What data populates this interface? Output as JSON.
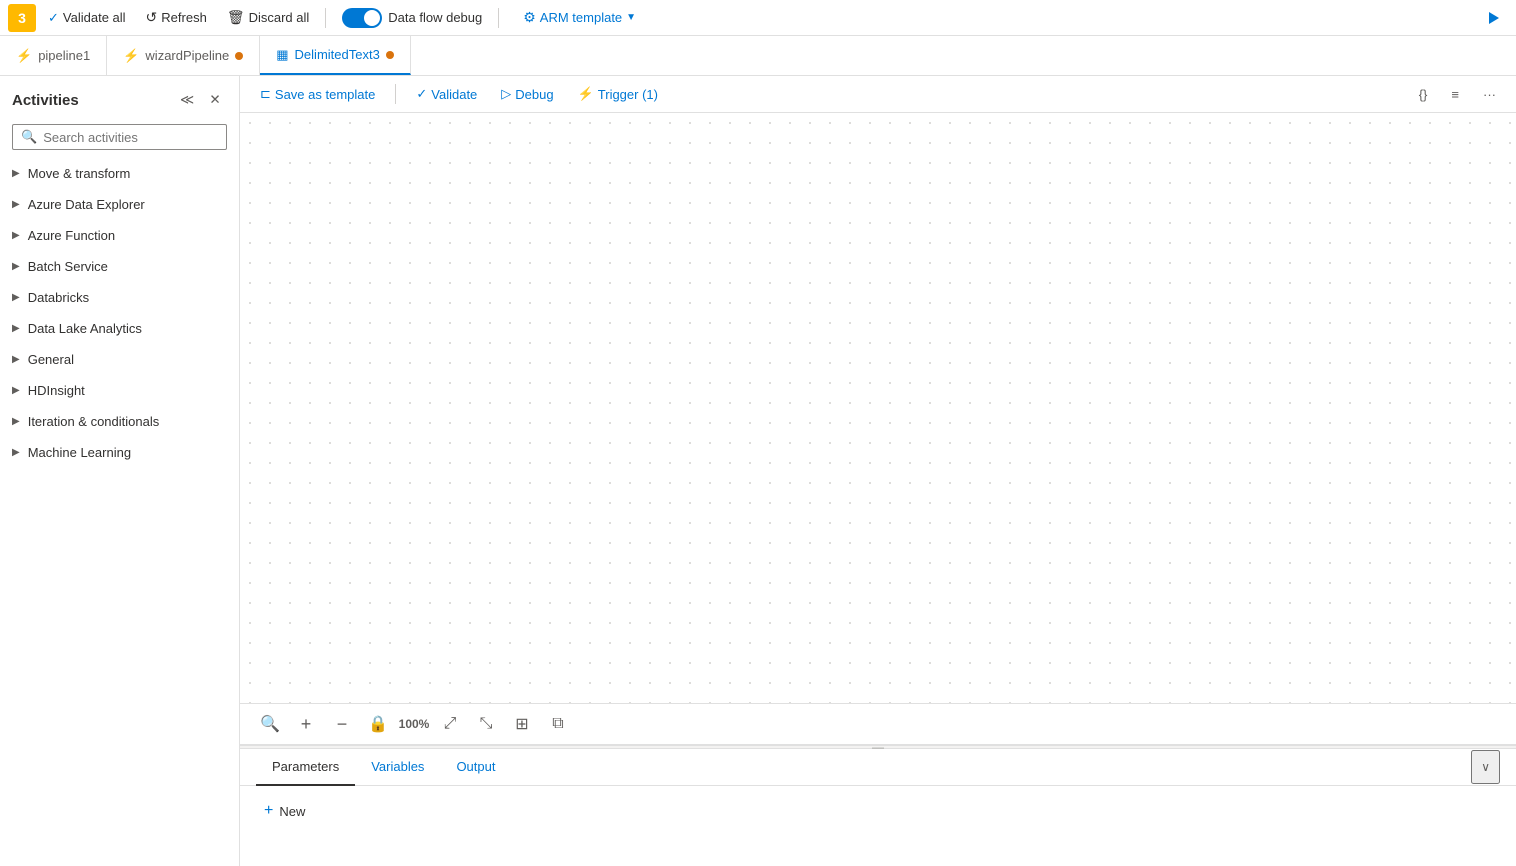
{
  "topToolbar": {
    "validateAll": "Validate all",
    "refresh": "Refresh",
    "discard": "Discard all",
    "dataFlowDebug": "Data flow debug",
    "armTemplate": "ARM template",
    "runIcon": "▶"
  },
  "tabs": [
    {
      "id": "pipeline1",
      "label": "pipeline1",
      "icon": "⚡",
      "active": false,
      "dot": false
    },
    {
      "id": "wizardPipeline",
      "label": "wizardPipeline",
      "icon": "⚡",
      "active": false,
      "dot": true
    },
    {
      "id": "DelimitedText3",
      "label": "DelimitedText3",
      "icon": "▦",
      "active": true,
      "dot": true
    }
  ],
  "sidebar": {
    "title": "Activities",
    "searchPlaceholder": "Search activities",
    "items": [
      {
        "label": "Move & transform"
      },
      {
        "label": "Azure Data Explorer"
      },
      {
        "label": "Azure Function"
      },
      {
        "label": "Batch Service"
      },
      {
        "label": "Databricks"
      },
      {
        "label": "Data Lake Analytics"
      },
      {
        "label": "General"
      },
      {
        "label": "HDInsight"
      },
      {
        "label": "Iteration & conditionals"
      },
      {
        "label": "Machine Learning"
      }
    ]
  },
  "pipelineToolbar": {
    "saveAsTemplate": "Save as template",
    "validate": "Validate",
    "debug": "Debug",
    "trigger": "Trigger (1)"
  },
  "canvasToolbar": {
    "search": "🔍",
    "add": "+",
    "remove": "−",
    "lock": "🔒",
    "zoom100": "⊡",
    "fitPage": "⤢",
    "fitSelection": "⤡",
    "autoLayout": "⊞",
    "miniMap": "⧉"
  },
  "bottomPanel": {
    "tabs": [
      {
        "label": "Parameters",
        "active": true
      },
      {
        "label": "Variables",
        "active": false
      },
      {
        "label": "Output",
        "active": false
      }
    ],
    "newLabel": "New"
  }
}
